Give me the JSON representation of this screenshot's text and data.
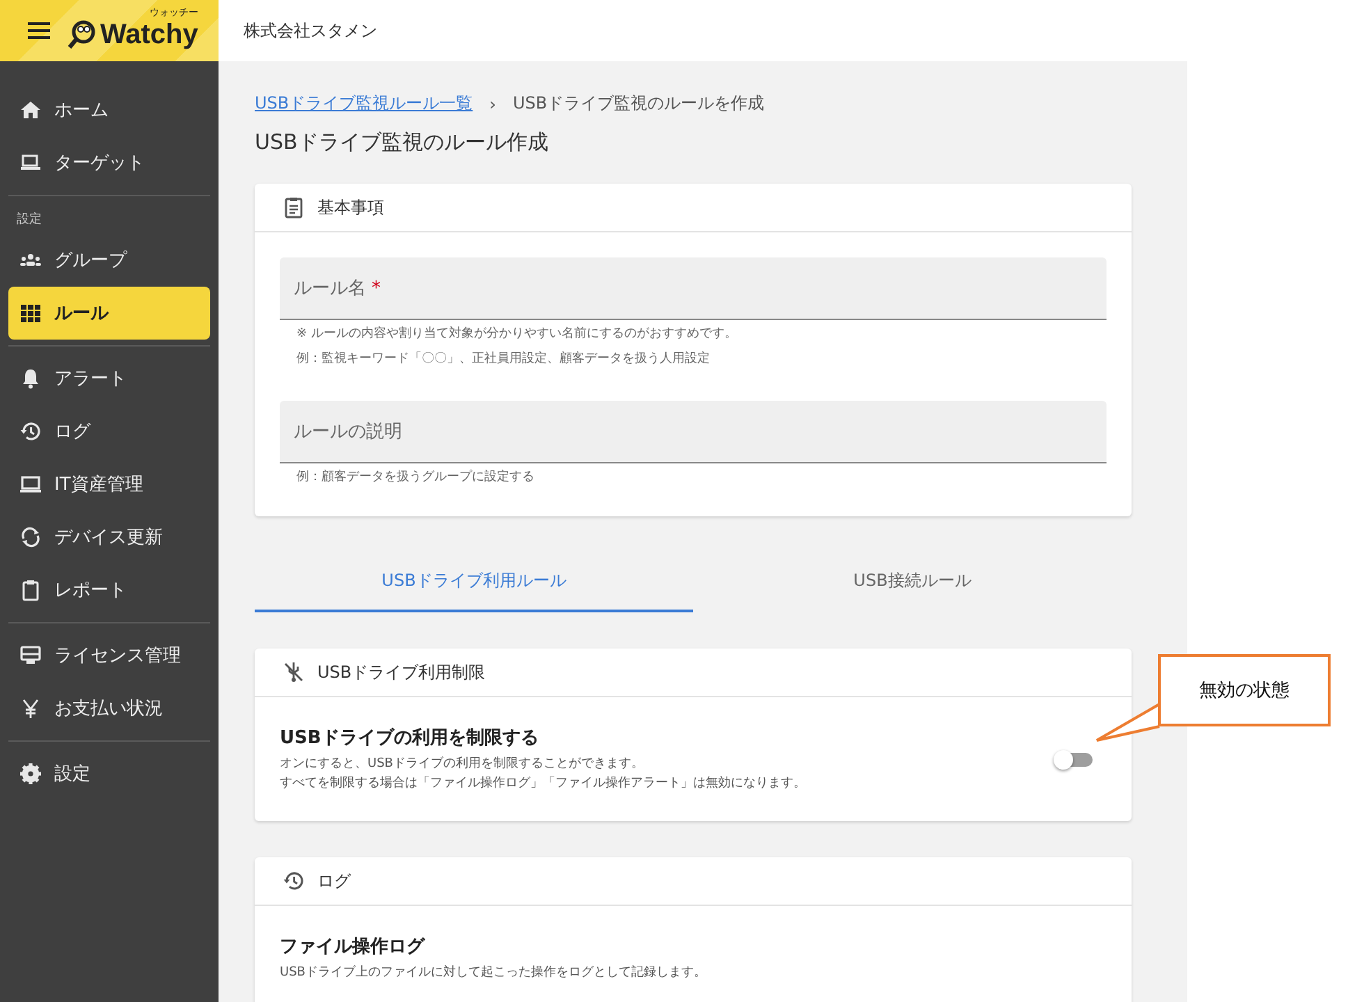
{
  "header": {
    "logo": "Watchy",
    "logo_ruby": "ウォッチー",
    "company": "株式会社スタメン"
  },
  "sidebar": {
    "groups": [
      {
        "items": [
          {
            "label": "ホーム",
            "selected": false
          },
          {
            "label": "ターゲット",
            "selected": false
          }
        ]
      },
      {
        "heading": "設定",
        "items": [
          {
            "label": "グループ",
            "selected": false
          },
          {
            "label": "ルール",
            "selected": true
          }
        ]
      },
      {
        "items": [
          {
            "label": "アラート",
            "selected": false
          },
          {
            "label": "ログ",
            "selected": false
          },
          {
            "label": "IT資産管理",
            "selected": false
          },
          {
            "label": "デバイス更新",
            "selected": false
          },
          {
            "label": "レポート",
            "selected": false
          }
        ]
      },
      {
        "items": [
          {
            "label": "ライセンス管理",
            "selected": false
          },
          {
            "label": "お支払い状況",
            "selected": false
          }
        ]
      },
      {
        "items": [
          {
            "label": "設定",
            "selected": false
          }
        ]
      }
    ]
  },
  "breadcrumb": {
    "link": "USBドライブ監視ルール一覧",
    "separator": "›",
    "current": "USBドライブ監視のルールを作成"
  },
  "page_title": "USBドライブ監視のルール作成",
  "basic_card": {
    "title": "基本事項",
    "fields": [
      {
        "label": "ルール名",
        "required_mark": "*",
        "hints": [
          "※ ルールの内容や割り当て対象が分かりやすい名前にするのがおすすめです。",
          "例：監視キーワード「〇〇」、正社員用設定、顧客データを扱う人用設定"
        ]
      },
      {
        "label": "ルールの説明",
        "hints": [
          "例：顧客データを扱うグループに設定する"
        ]
      }
    ]
  },
  "tabs": [
    {
      "label": "USBドライブ利用ルール",
      "selected": true
    },
    {
      "label": "USB接続ルール",
      "selected": false
    }
  ],
  "sections": [
    {
      "title": "USBドライブ利用制限",
      "settings": [
        {
          "name": "USBドライブの利用を制限する",
          "description": [
            "オンにすると、USBドライブの利用を制限することができます。",
            "すべてを制限する場合は「ファイル操作ログ」「ファイル操作アラート」は無効になります。"
          ],
          "on": false
        }
      ]
    },
    {
      "title": "ログ",
      "settings": [
        {
          "name": "ファイル操作ログ",
          "description": [
            "USBドライブ上のファイルに対して起こった操作をログとして記録します。"
          ]
        }
      ]
    }
  ],
  "callout": {
    "text": "無効の状態"
  }
}
